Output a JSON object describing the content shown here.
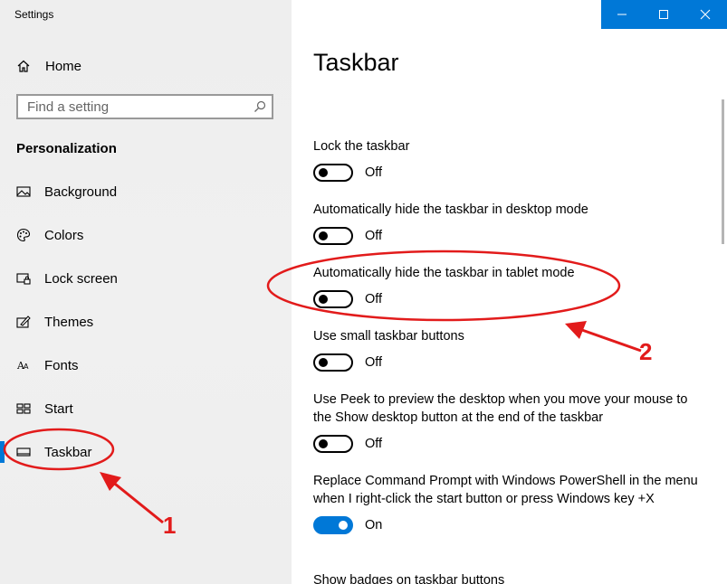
{
  "window": {
    "title": "Settings"
  },
  "sidebar": {
    "home_label": "Home",
    "search_placeholder": "Find a setting",
    "section": "Personalization",
    "items": [
      {
        "label": "Background",
        "icon": "picture-icon"
      },
      {
        "label": "Colors",
        "icon": "palette-icon"
      },
      {
        "label": "Lock screen",
        "icon": "lock-screen-icon"
      },
      {
        "label": "Themes",
        "icon": "themes-icon"
      },
      {
        "label": "Fonts",
        "icon": "fonts-icon"
      },
      {
        "label": "Start",
        "icon": "start-icon"
      },
      {
        "label": "Taskbar",
        "icon": "taskbar-icon",
        "active": true
      }
    ]
  },
  "main": {
    "title": "Taskbar",
    "settings": [
      {
        "label": "Lock the taskbar",
        "state": "Off",
        "on": false
      },
      {
        "label": "Automatically hide the taskbar in desktop mode",
        "state": "Off",
        "on": false
      },
      {
        "label": "Automatically hide the taskbar in tablet mode",
        "state": "Off",
        "on": false
      },
      {
        "label": "Use small taskbar buttons",
        "state": "Off",
        "on": false
      },
      {
        "label": "Use Peek to preview the desktop when you move your mouse to the Show desktop button at the end of the taskbar",
        "state": "Off",
        "on": false
      },
      {
        "label": "Replace Command Prompt with Windows PowerShell in the menu when I right-click the start button or press Windows key +X",
        "state": "On",
        "on": true
      },
      {
        "label": "Show badges on taskbar buttons"
      }
    ]
  },
  "annotations": {
    "num1": "1",
    "num2": "2"
  },
  "colors": {
    "accent": "#0078d7",
    "annotation": "#e21b1b"
  }
}
